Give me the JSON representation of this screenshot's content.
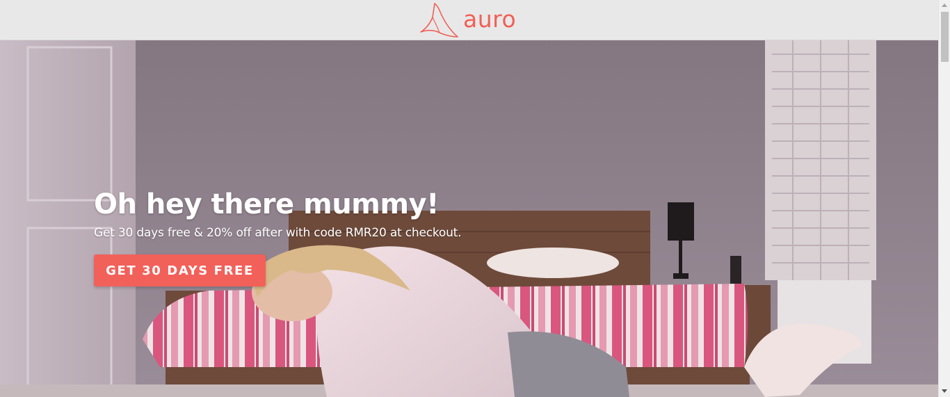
{
  "brand": {
    "name": "auro",
    "logo_icon": "auro-peak-icon",
    "accent_color": "#f15f55"
  },
  "hero": {
    "title": "Oh hey there mummy!",
    "subtitle": "Get 30 days free & 20% off after with code RMR20 at checkout.",
    "cta_label": "GET 30 DAYS FREE",
    "cta_color": "#f2605a",
    "background_image": "woman-stretching-on-bedroom-floor"
  },
  "scrollbar": {
    "up_icon": "scroll-up-arrow-icon",
    "down_icon": "scroll-down-arrow-icon"
  }
}
